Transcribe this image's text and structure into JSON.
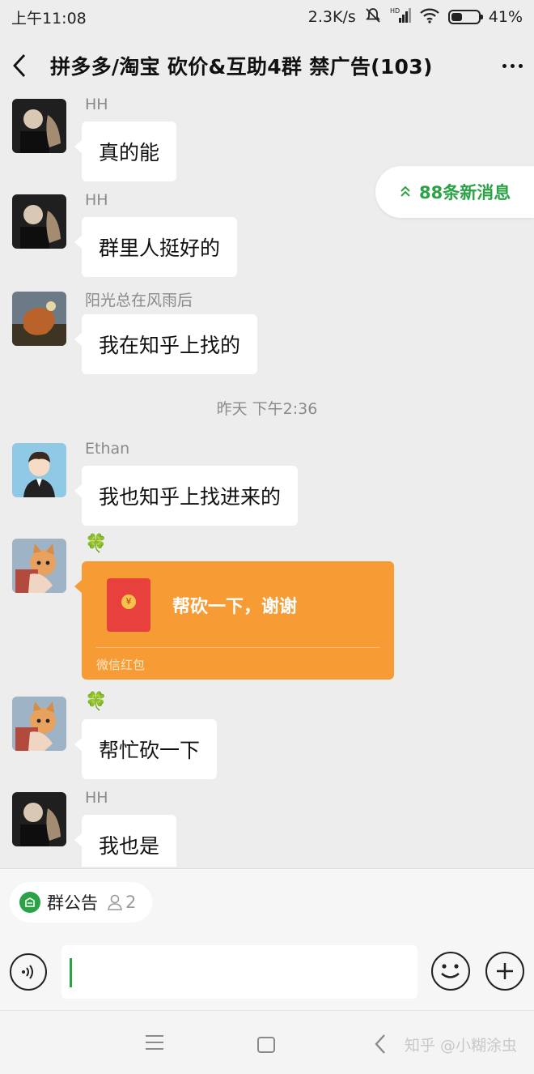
{
  "status_bar": {
    "time": "上午11:08",
    "network_speed": "2.3K/s",
    "network_badge": "HD",
    "battery_percent": "41%",
    "battery_level": 0.41,
    "icons": [
      "mute-icon",
      "signal-icon",
      "wifi-icon",
      "battery-icon"
    ]
  },
  "header": {
    "title": "拼多多/淘宝  砍价&互助4群 禁广告(103)",
    "back_icon": "chevron-left-icon",
    "more_icon": "more-dots-icon"
  },
  "new_messages_pill": {
    "label": "88条新消息",
    "icon": "double-chevron-up-icon"
  },
  "messages": [
    {
      "sender": "HH",
      "text": "真的能",
      "avatar": "avatar-hh"
    },
    {
      "sender": "HH",
      "text": "群里人挺好的",
      "avatar": "avatar-hh"
    },
    {
      "sender": "阳光总在风雨后",
      "text": "我在知乎上找的",
      "avatar": "avatar-sunshine"
    },
    {
      "sender": "Ethan",
      "text": "我也知乎上找进来的",
      "avatar": "avatar-ethan"
    },
    {
      "sender": "🍀",
      "type": "red_packet",
      "text": "帮砍一下，谢谢",
      "label": "微信红包",
      "avatar": "avatar-cat"
    },
    {
      "sender": "🍀",
      "text": "帮忙砍一下",
      "avatar": "avatar-cat"
    },
    {
      "sender": "HH",
      "text": "我也是",
      "avatar": "avatar-hh"
    }
  ],
  "time_divider": "昨天 下午2:36",
  "red_packet_coin": "¥",
  "group_notice": {
    "label": "群公告",
    "count": "2",
    "icon": "notice-icon",
    "people_icon": "person-icon"
  },
  "input_bar": {
    "voice_icon": "voice-icon",
    "emoji_icon": "emoji-icon",
    "plus_icon": "plus-icon",
    "value": ""
  },
  "system_nav": {
    "icons": [
      "menu-icon",
      "home-icon",
      "back-icon"
    ]
  },
  "watermark": "知乎 @小糊涂虫",
  "colors": {
    "accent": "#2ba245",
    "red_packet": "#f79b34",
    "background": "#ededed"
  }
}
